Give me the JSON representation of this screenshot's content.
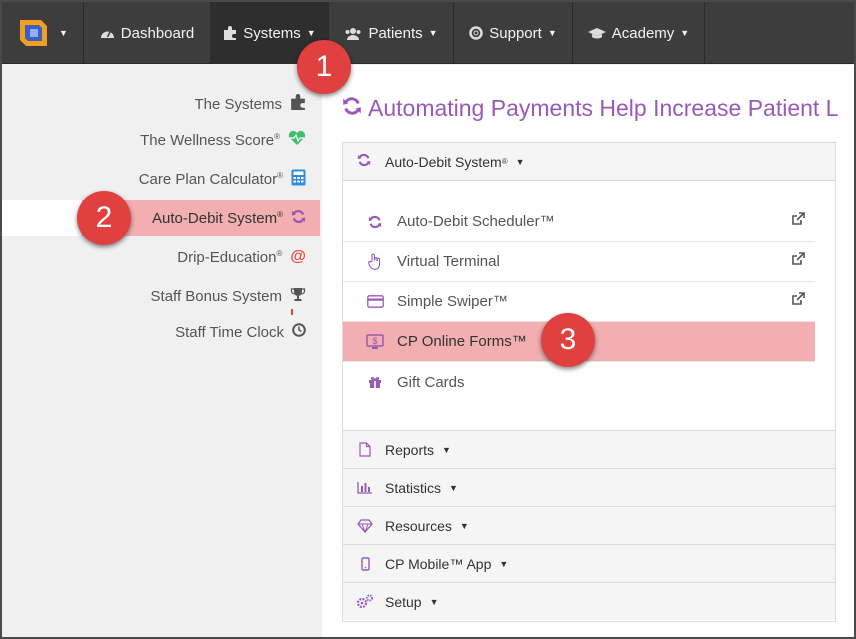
{
  "navbar": {
    "items": [
      {
        "label": "Dashboard"
      },
      {
        "label": "Systems"
      },
      {
        "label": "Patients"
      },
      {
        "label": "Support"
      },
      {
        "label": "Academy"
      }
    ]
  },
  "sidebar": {
    "items": [
      {
        "label": "The Systems",
        "icon": "puzzle-icon"
      },
      {
        "label": "The Wellness Score",
        "sup": "®",
        "icon": "heartbeat-icon"
      },
      {
        "label": "Care Plan Calculator",
        "sup": "®",
        "icon": "calculator-icon"
      },
      {
        "label": "Auto-Debit System",
        "sup": "®",
        "icon": "refresh-icon"
      },
      {
        "label": "Drip-Education",
        "sup": "®",
        "icon": "at-icon"
      },
      {
        "label": "Staff Bonus System",
        "icon": "trophy-icon"
      },
      {
        "label": "Staff Time Clock",
        "icon": "clock-icon"
      }
    ]
  },
  "main": {
    "title": "Automating Payments Help Increase Patient L",
    "panel": {
      "header": "Auto-Debit System",
      "header_sup": "®",
      "items": [
        {
          "label": "Auto-Debit Scheduler™",
          "icon": "refresh-icon",
          "external": true
        },
        {
          "label": "Virtual Terminal",
          "icon": "hand-pointer-icon",
          "external": true
        },
        {
          "label": "Simple Swiper™",
          "icon": "credit-card-icon",
          "external": true
        },
        {
          "label": "CP Online Forms™",
          "icon": "monitor-dollar-icon",
          "external": false
        },
        {
          "label": "Gift Cards",
          "icon": "gift-icon",
          "external": false
        }
      ]
    },
    "sections": [
      {
        "label": "Reports",
        "icon": "file-icon"
      },
      {
        "label": "Statistics",
        "icon": "bar-chart-icon"
      },
      {
        "label": "Resources",
        "icon": "diamond-icon"
      },
      {
        "label": "CP Mobile™ App",
        "icon": "mobile-icon"
      },
      {
        "label": "Setup",
        "icon": "cogs-icon"
      }
    ]
  },
  "callouts": [
    "1",
    "2",
    "3"
  ],
  "colors": {
    "navbar": "#3d3d3d",
    "accent_purple": "#9b59b6",
    "highlight_pink": "#f2aeb0",
    "callout_red": "#e0403f"
  }
}
